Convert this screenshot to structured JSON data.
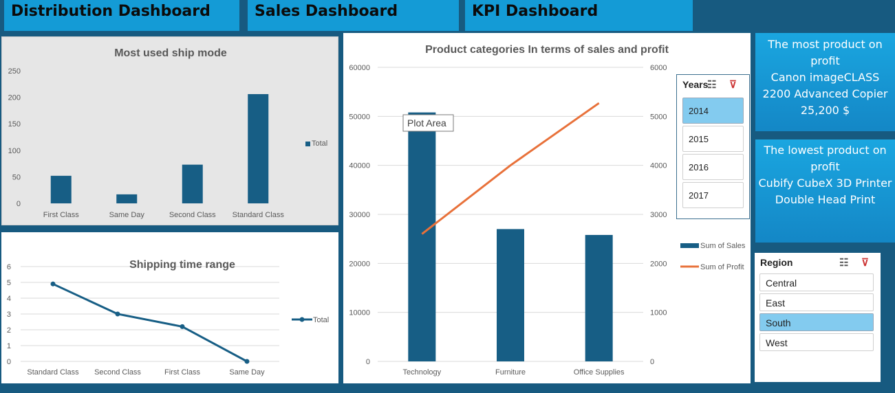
{
  "tabs": {
    "distribution": "Distribution Dashboard",
    "sales": "Sales Dashboard",
    "kpi": "KPI Dashboard"
  },
  "info_cards": {
    "most_title": "The most product on profit",
    "most_product": "Canon imageCLASS 2200 Advanced Copier",
    "most_value": "25,200  $",
    "lowest_title": "The lowest product on profit",
    "lowest_product": "Cubify CubeX 3D Printer Double Head Print"
  },
  "slicers": {
    "years": {
      "title": "Years",
      "items": [
        "2014",
        "2015",
        "2016",
        "2017"
      ],
      "selected": "2014"
    },
    "region": {
      "title": "Region",
      "items": [
        "Central",
        "East",
        "South",
        "West"
      ],
      "selected": "South"
    }
  },
  "tooltip": "Plot Area",
  "colors": {
    "bar": "#175e85",
    "profit_line": "#e8713a",
    "tab": "#149bd6",
    "background": "#175a80",
    "selected_item": "#83cbef"
  },
  "icons": [
    "multi-select-icon",
    "clear-filter-icon"
  ],
  "chart_data": [
    {
      "type": "bar",
      "title": "Most used ship mode",
      "categories": [
        "First Class",
        "Same Day",
        "Second Class",
        "Standard Class"
      ],
      "series": [
        {
          "name": "Total",
          "values": [
            52,
            17,
            73,
            206
          ]
        }
      ],
      "ylim": [
        0,
        250
      ],
      "yticks": [
        0,
        50,
        100,
        150,
        200,
        250
      ],
      "grid": false,
      "legend": "right"
    },
    {
      "type": "line",
      "title": "Shipping time range",
      "categories": [
        "Standard Class",
        "Second Class",
        "First Class",
        "Same Day"
      ],
      "series": [
        {
          "name": "Total",
          "values": [
            4.9,
            3.0,
            2.2,
            0
          ]
        }
      ],
      "ylim": [
        0,
        6
      ],
      "yticks": [
        0,
        1,
        2,
        3,
        4,
        5,
        6
      ],
      "grid": true,
      "legend": "right"
    },
    {
      "type": "bar",
      "title": "Product categories In terms of sales and profit",
      "categories": [
        "Technology",
        "Furniture",
        "Office Supplies"
      ],
      "series": [
        {
          "name": "Sum of Sales",
          "type": "bar",
          "axis": "left",
          "values": [
            50800,
            27000,
            25800
          ]
        },
        {
          "name": "Sum of Profit",
          "type": "line",
          "axis": "right",
          "values": [
            2600,
            4000,
            5270
          ]
        }
      ],
      "ylim": [
        0,
        60000
      ],
      "yticks": [
        0,
        10000,
        20000,
        30000,
        40000,
        50000,
        60000
      ],
      "y2lim": [
        0,
        6000
      ],
      "y2ticks": [
        0,
        1000,
        2000,
        3000,
        4000,
        5000,
        6000
      ],
      "grid": true,
      "legend": "right"
    }
  ]
}
